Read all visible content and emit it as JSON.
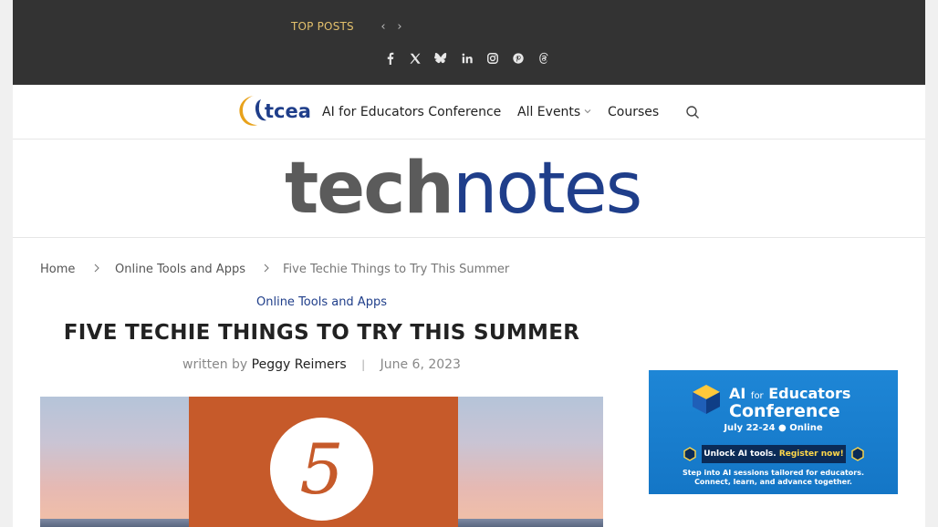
{
  "topbar": {
    "label": "TOP POSTS",
    "prev_glyph": "‹",
    "next_glyph": "›",
    "social_icons": [
      "facebook-icon",
      "x-icon",
      "bluesky-icon",
      "linkedin-icon",
      "instagram-icon",
      "pinterest-icon",
      "threads-icon"
    ]
  },
  "nav": {
    "logo_text": "tcea",
    "items": [
      {
        "label": "AI for Educators Conference"
      },
      {
        "label": "All Events",
        "has_dropdown": true
      },
      {
        "label": "Courses"
      }
    ],
    "search_icon": "search-icon"
  },
  "masthead": {
    "brand_part1": "tech",
    "brand_part2": "notes"
  },
  "breadcrumb": [
    {
      "label": "Home"
    },
    {
      "label": "Online Tools and Apps"
    },
    {
      "label": "Five Techie Things to Try This Summer"
    }
  ],
  "article": {
    "category": "Online Tools and Apps",
    "title": "FIVE TECHIE THINGS TO TRY THIS SUMMER",
    "written_by": "written by",
    "author": "Peggy Reimers",
    "date": "June 6, 2023",
    "image_number": "5"
  },
  "ad": {
    "line1_a": "AI",
    "line1_b": "for",
    "line1_c": "Educators",
    "line2": "Conference",
    "dates": "July 22-24 ● Online",
    "button_a": "Unlock AI tools.",
    "button_b": "Register now!",
    "footer1": "Step into AI sessions tailored for educators.",
    "footer2": "Connect, learn, and advance together."
  },
  "colors": {
    "topbar_bg": "#333333",
    "accent_gold": "#e3c06c",
    "brand_blue": "#1f3e8a",
    "brand_gray": "#5b5b5b",
    "hero_orange": "#c65a2a",
    "ad_blue": "#1578c9"
  }
}
